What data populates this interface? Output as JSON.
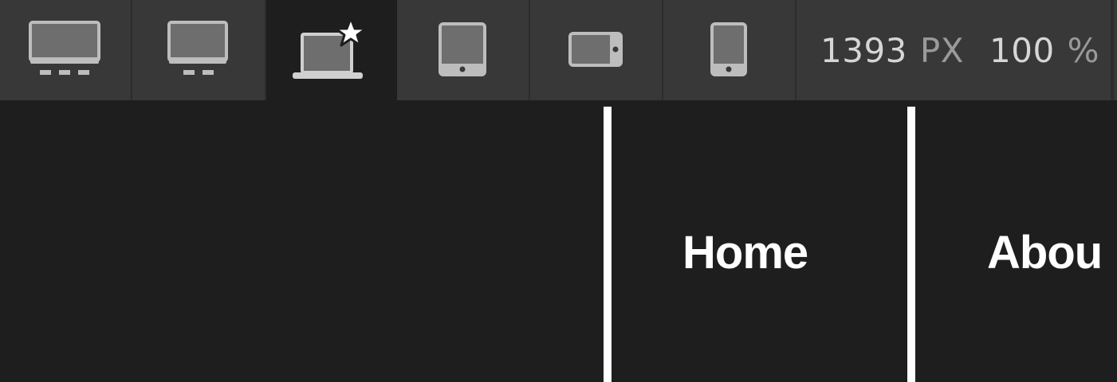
{
  "toolbar": {
    "breakpoints": [
      {
        "icon": "desktop-large-icon"
      },
      {
        "icon": "desktop-icon"
      },
      {
        "icon": "laptop-star-icon",
        "active": true
      },
      {
        "icon": "tablet-portrait-icon"
      },
      {
        "icon": "tablet-landscape-icon"
      },
      {
        "icon": "phone-icon"
      }
    ],
    "width_value": "1393",
    "width_unit": "PX",
    "zoom_value": "100",
    "zoom_unit": "%"
  },
  "canvas": {
    "nav": {
      "home": "Home",
      "about": "Abou"
    }
  },
  "colors": {
    "toolbar_bg": "#383838",
    "active_bg": "#1e1e1e",
    "canvas_bg": "#1e1e1e",
    "icon_fill": "#6e6e6e",
    "icon_stroke": "#bdbdbd",
    "text": "#ffffff"
  }
}
